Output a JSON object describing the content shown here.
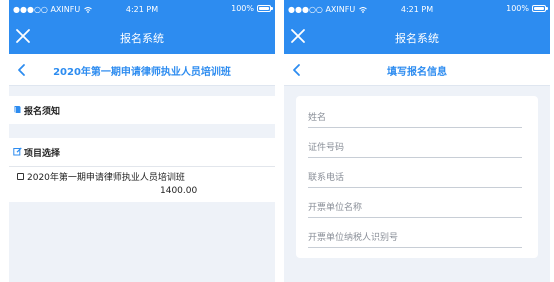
{
  "status_bar": {
    "carrier": "●●●○○ AXINFU",
    "time": "4:21 PM",
    "battery": "100%"
  },
  "app_title": "报名系统",
  "left": {
    "subtitle": "2020年第一期申请律师执业人员培训班",
    "notice_label": "报名须知",
    "projects_label": "项目选择",
    "project_item": "2020年第一期申请律师执业人员培训班",
    "project_price": "1400.00"
  },
  "right": {
    "subtitle": "填写报名信息",
    "fields": [
      {
        "placeholder": "姓名"
      },
      {
        "placeholder": "证件号码"
      },
      {
        "placeholder": "联系电话"
      },
      {
        "placeholder": "开票单位名称"
      },
      {
        "placeholder": "开票单位纳税人识别号"
      }
    ]
  },
  "colors": {
    "brand": "#2d8cf0",
    "page_bg": "#eef2f8",
    "card_bg": "#ffffff"
  },
  "icons": {
    "close": "close-icon",
    "back": "chevron-left-icon",
    "notice": "book-icon",
    "select": "edit-icon",
    "wifi": "wifi-icon",
    "battery": "battery-icon"
  }
}
